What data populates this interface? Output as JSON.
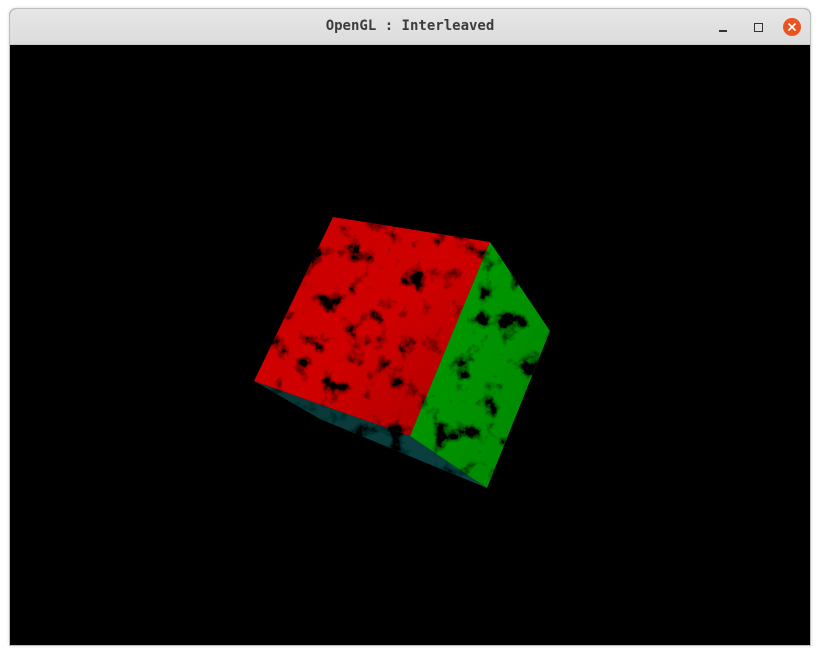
{
  "window": {
    "title": "OpenGL : Interleaved"
  },
  "controls": {
    "minimize_icon": "minimize-icon",
    "maximize_icon": "maximize-icon",
    "close_icon": "close-icon"
  },
  "scene": {
    "background_color": "#000000",
    "cube": {
      "face_colors": {
        "front": "#c40000",
        "right": "#009a00",
        "bottom": "#0c4b4b"
      },
      "texture": "marble"
    }
  },
  "colors": {
    "titlebar": "#dedede",
    "close_button": "#e95420"
  }
}
